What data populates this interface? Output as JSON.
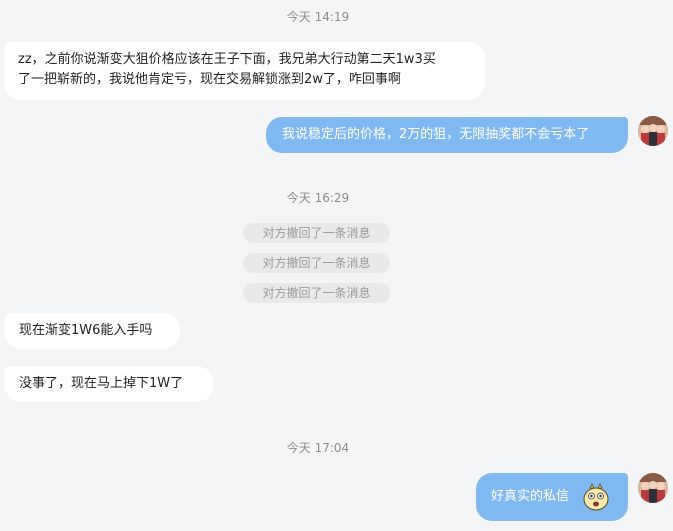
{
  "timestamps": [
    "今天 14:19",
    "今天 16:29",
    "今天 17:04"
  ],
  "messages": {
    "m1_line1": "zz，之前你说渐变大狙价格应该在王子下面，我兄弟大行动第二天1w3买",
    "m1_line2": "了一把崭新的，我说他肯定亏，现在交易解锁涨到2w了，咋回事啊",
    "m2": "我说稳定后的价格，2万的狙，无限抽奖都不会亏本了",
    "m3": "现在渐变1W6能入手吗",
    "m4": "没事了，现在马上掉下1W了",
    "m5": "好真实的私信"
  },
  "recalled": [
    "对方撤回了一条消息",
    "对方撤回了一条消息",
    "对方撤回了一条消息"
  ],
  "colors": {
    "background": "#f4f5f7",
    "incoming_bubble": "#ffffff",
    "outgoing_bubble": "#80b9f2",
    "timestamp_text": "#8c8c8c"
  },
  "icons": {
    "avatar": "user-avatar",
    "emoji": "surprised-face-emoji"
  }
}
